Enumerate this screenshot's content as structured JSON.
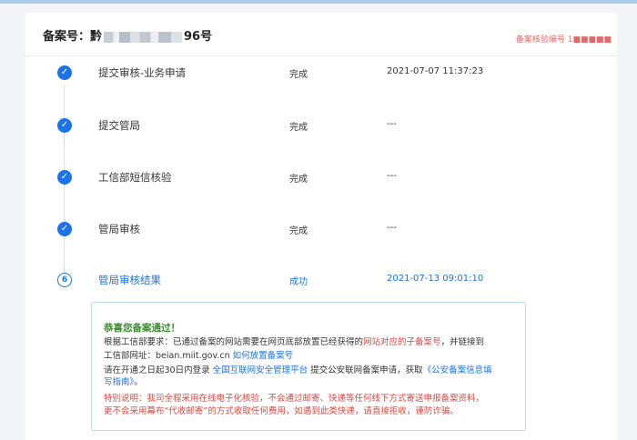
{
  "header": {
    "record_prefix": "备案号：黔",
    "record_suffix": "96号",
    "right_text": "备案核验编号  1■■■■■"
  },
  "steps": [
    {
      "name": "提交审核-业务申请",
      "status": "完成",
      "time": "2021-07-07 11:37:23"
    },
    {
      "name": "提交管局",
      "status": "完成",
      "time": "---"
    },
    {
      "name": "工信部短信核验",
      "status": "完成",
      "time": "---"
    },
    {
      "name": "管局审核",
      "status": "完成",
      "time": "---"
    },
    {
      "index": "6",
      "name": "管局审核结果",
      "status": "成功",
      "time": "2021-07-13 09:01:10"
    }
  ],
  "result": {
    "congrats": "恭喜您备案通过！",
    "line1_a": "根据工信部要求：已通过备案的网站需要在网页底部放置已经获得的",
    "line1_red": "网站对应的子备案号",
    "line1_b": "，并链接到",
    "line2_a": "工信部网址：beian.miit.gov.cn  ",
    "line2_link": "如何放置备案号",
    "line3_a": "请在开通之日起30日内登录  ",
    "line3_blue": "全国互联网安全管理平台",
    "line3_b": "  提交公安联网备案申请，获取",
    "line3_link": "《公安备案信息填",
    "line4_link": "写指南》",
    "line4_b": "。",
    "notice1": "特别说明：我司全程采用在线电子化核验，不会通过邮寄、快递等任何线下方式寄送申报备案资料，",
    "notice2": "更不会采用幕布“代收邮寄”的方式收取任何费用，如遇到此类快递，请直接拒收，谨防诈骗。"
  },
  "colors": {
    "accent": "#1a73e8",
    "success_green": "#3f8a32",
    "warning_red": "#e0463f",
    "box_border": "#b9daef"
  },
  "icons": {
    "done": "check-circle-icon",
    "current": "step-number-icon"
  }
}
